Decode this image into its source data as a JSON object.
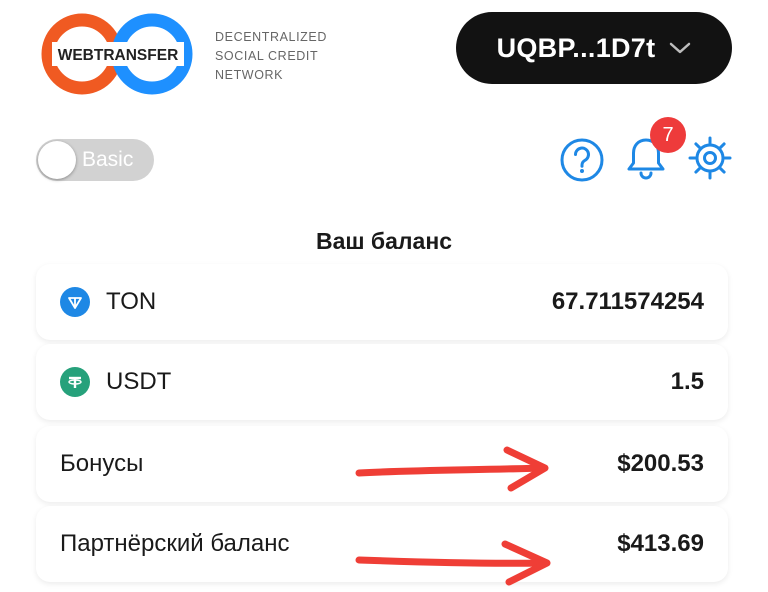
{
  "header": {
    "logo_text": "WEBTRANSFER",
    "tagline": [
      "DECENTRALIZED",
      "SOCIAL CREDIT",
      "NETWORK"
    ],
    "wallet_address": "UQBP...1D7t"
  },
  "toolbar": {
    "mode_toggle_label": "Basic",
    "notification_count": "7"
  },
  "balance": {
    "title": "Ваш баланс",
    "rows": [
      {
        "label": "TON",
        "value": "67.711574254",
        "icon": "ton-icon"
      },
      {
        "label": "USDT",
        "value": "1.5",
        "icon": "usdt-icon"
      },
      {
        "label": "Бонусы",
        "value": "$200.53"
      },
      {
        "label": "Партнёрский баланс",
        "value": "$413.69"
      }
    ]
  },
  "colors": {
    "accent_blue": "#1e88e5",
    "badge_red": "#ee3b3b",
    "logo_orange": "#f05a22",
    "logo_blue": "#1e90ff",
    "annotation_red": "#ef3e36"
  }
}
